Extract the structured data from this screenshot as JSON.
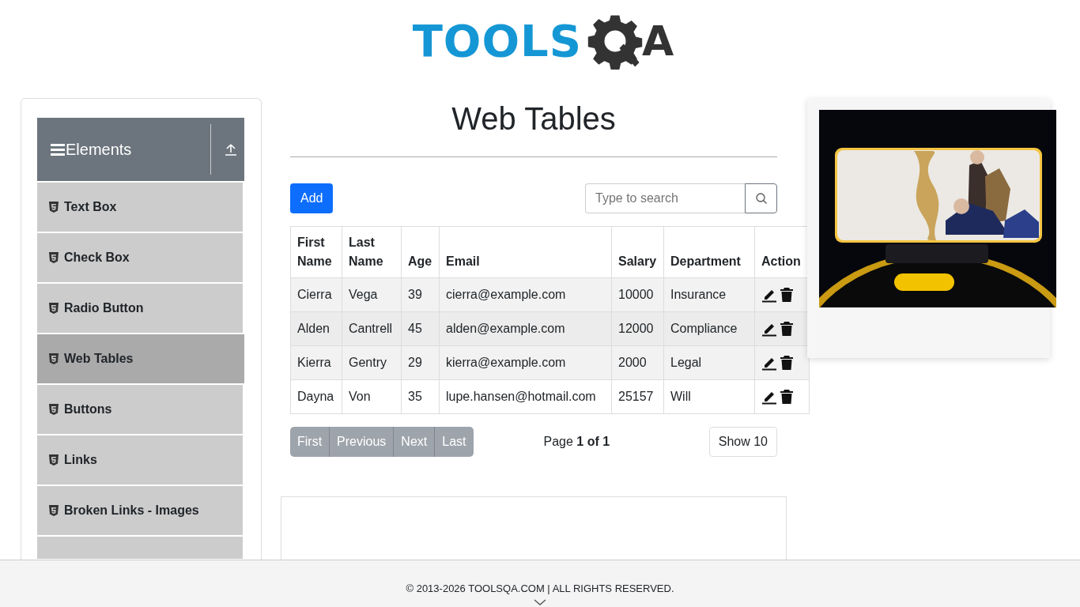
{
  "logo": {
    "text": "TOOLS",
    "suffix": "A"
  },
  "sidebar": {
    "group": {
      "title": "Elements"
    },
    "items": [
      {
        "label": "Text Box",
        "selected": false
      },
      {
        "label": "Check Box",
        "selected": false
      },
      {
        "label": "Radio Button",
        "selected": false
      },
      {
        "label": "Web Tables",
        "selected": true
      },
      {
        "label": "Buttons",
        "selected": false
      },
      {
        "label": "Links",
        "selected": false
      },
      {
        "label": "Broken Links - Images",
        "selected": false
      }
    ]
  },
  "page_title": "Web Tables",
  "add_button": "Add",
  "search": {
    "placeholder": "Type to search"
  },
  "table": {
    "columns": [
      "First Name",
      "Last Name",
      "Age",
      "Email",
      "Salary",
      "Department",
      "Action"
    ],
    "rows": [
      {
        "cells": [
          "Cierra",
          "Vega",
          "39",
          "cierra@example.com",
          "10000",
          "Insurance"
        ]
      },
      {
        "cells": [
          "Alden",
          "Cantrell",
          "45",
          "alden@example.com",
          "12000",
          "Compliance"
        ]
      },
      {
        "cells": [
          "Kierra",
          "Gentry",
          "29",
          "kierra@example.com",
          "2000",
          "Legal"
        ]
      },
      {
        "cells": [
          "Dayna",
          "Von",
          "35",
          "lupe.hansen@hotmail.com",
          "25157",
          "Will"
        ]
      }
    ]
  },
  "pagination": {
    "buttons": [
      {
        "label": "First",
        "disabled": true
      },
      {
        "label": "Previous",
        "disabled": true
      },
      {
        "label": "Next",
        "disabled": true
      },
      {
        "label": "Last",
        "disabled": true
      }
    ],
    "page_label": "Page **1 of 1**",
    "page_size": "Show 10"
  },
  "footer": {
    "text": "© 2013-2026 TOOLSQA.COM | ALL RIGHTS RESERVED."
  }
}
